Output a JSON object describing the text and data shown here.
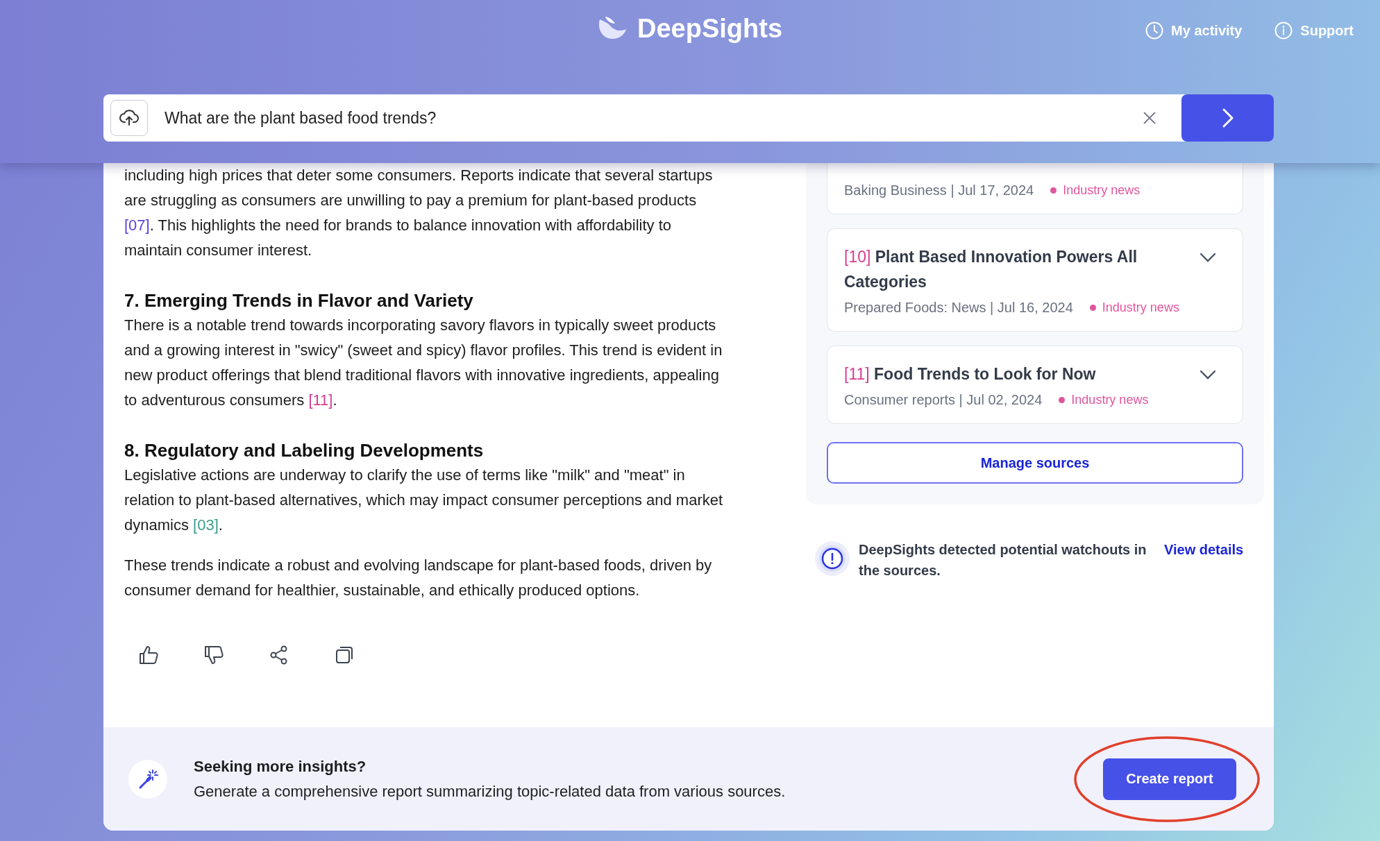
{
  "header": {
    "brand": "DeepSights",
    "nav": [
      {
        "kind": "clock",
        "label": "My activity"
      },
      {
        "kind": "info",
        "label": "Support"
      }
    ]
  },
  "search": {
    "value": "What are the plant based food trends?"
  },
  "answer": [
    {
      "kind": "paragraph",
      "parts": [
        {
          "text": "including high prices that deter some consumers. Reports indicate that several startups are struggling as consumers are unwilling to pay a premium for plant-based products "
        },
        {
          "text": "[07]",
          "color": "#5b3fe0"
        },
        {
          "text": ". This highlights the need for brands to balance innovation with affordability to maintain consumer interest."
        }
      ]
    },
    {
      "kind": "heading",
      "parts": [
        {
          "text": "7. Emerging Trends in Flavor and Variety"
        }
      ]
    },
    {
      "kind": "paragraph",
      "parts": [
        {
          "text": "There is a notable trend towards incorporating savory flavors in typically sweet products and a growing interest in \"swicy\" (sweet and spicy) flavor profiles. This trend is evident in new product offerings that blend traditional flavors with innovative ingredients, appealing to adventurous consumers "
        },
        {
          "text": "[11]",
          "color": "#d63c8f"
        },
        {
          "text": "."
        }
      ]
    },
    {
      "kind": "heading",
      "parts": [
        {
          "text": "8. Regulatory and Labeling Developments"
        }
      ]
    },
    {
      "kind": "paragraph",
      "parts": [
        {
          "text": "Legislative actions are underway to clarify the use of terms like \"milk\" and \"meat\" in relation to plant-based alternatives, which may impact consumer perceptions and market dynamics "
        },
        {
          "text": "[03]",
          "color": "#3a9e8c"
        },
        {
          "text": "."
        }
      ]
    },
    {
      "kind": "paragraph",
      "parts": [
        {
          "text": "These trends indicate a robust and evolving landscape for plant-based foods, driven by consumer demand for healthier, sustainable, and ethically produced options."
        }
      ]
    }
  ],
  "feedback_actions": [
    {
      "kind": "thumbs-up"
    },
    {
      "kind": "thumbs-down"
    },
    {
      "kind": "share"
    },
    {
      "kind": "copy"
    }
  ],
  "sources": [
    {
      "meta": "Baking Business | Jul 17, 2024",
      "tag": "Industry news",
      "color": "#e0559e"
    },
    {
      "number": "[10]",
      "title": "Plant Based Innovation Powers All Categories",
      "meta": "Prepared Foods: News | Jul 16, 2024",
      "tag": "Industry news",
      "color": "#e0559e"
    },
    {
      "number": "[11]",
      "title": "Food Trends to Look for Now",
      "meta": "Consumer reports | Jul 02, 2024",
      "tag": "Industry news",
      "color": "#e0559e"
    }
  ],
  "manage_button": "Manage sources",
  "watchout": {
    "text": "DeepSights detected potential watchouts in the sources.",
    "link": "View details"
  },
  "insights": {
    "title": "Seeking more insights?",
    "description": "Generate a comprehensive report summarizing topic-related data from various sources.",
    "button": "Create report",
    "highlighted": true
  }
}
